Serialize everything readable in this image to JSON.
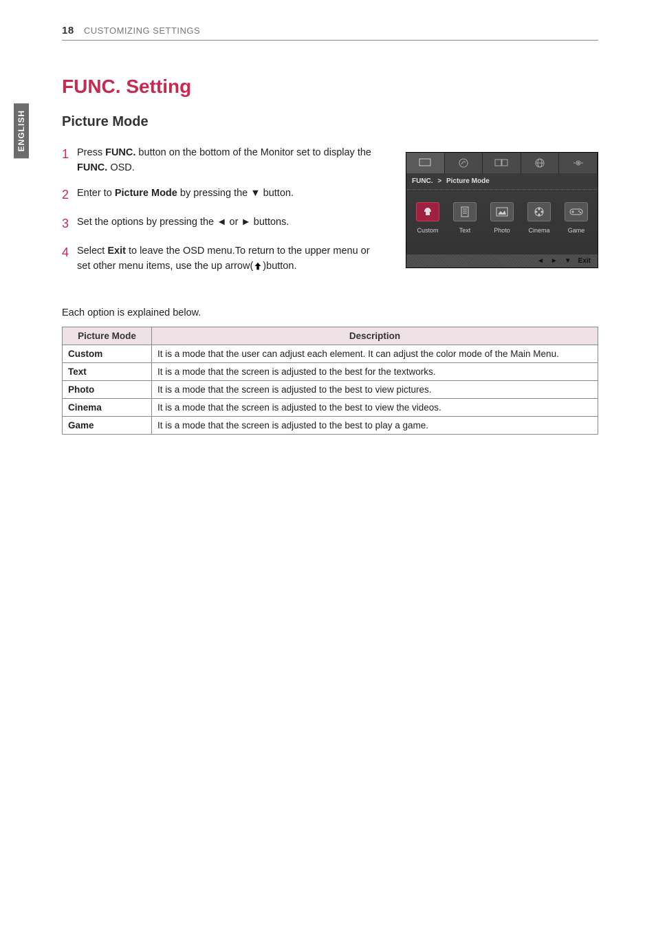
{
  "header": {
    "page_number": "18",
    "section": "CUSTOMIZING SETTINGS",
    "side_tab": "ENGLISH"
  },
  "title": "FUNC. Setting",
  "subtitle": "Picture Mode",
  "steps": {
    "s1": {
      "num": "1",
      "pre": "Press ",
      "b1": "FUNC.",
      "mid": " button on   the bottom of the Monitor set to display the ",
      "b2": "FUNC.",
      "post": " OSD."
    },
    "s2": {
      "num": "2",
      "pre": "Enter to ",
      "b1": "Picture Mode",
      "post": " by pressing the ▼ button."
    },
    "s3": {
      "num": "3",
      "text": "Set the options by pressing the ◄ or ► buttons."
    },
    "s4": {
      "num": "4",
      "pre": "Select ",
      "b1": "Exit",
      "post": " to leave the OSD menu.To return to the upper menu or set other menu items, use  the up arrow(",
      "post2": ")button."
    }
  },
  "explain_intro": "Each option is explained below.",
  "table": {
    "headers": {
      "mode": "Picture Mode",
      "desc": "Description"
    },
    "rows": [
      {
        "mode": "Custom",
        "desc": "It is a mode that the user can adjust each element. It can adjust the color mode of the Main Menu."
      },
      {
        "mode": "Text",
        "desc": "It is a mode that the screen is adjusted to the best for the textworks."
      },
      {
        "mode": "Photo",
        "desc": "It is a mode that the screen is adjusted to the best to view pictures."
      },
      {
        "mode": "Cinema",
        "desc": "It is a mode that the screen is adjusted to the best to view the videos."
      },
      {
        "mode": "Game",
        "desc": "It is a mode that the screen is adjusted to the best to play a game."
      }
    ]
  },
  "osd": {
    "breadcrumb_left": "FUNC.",
    "breadcrumb_sep": ">",
    "breadcrumb_right": "Picture Mode",
    "modes": [
      {
        "label": "Custom"
      },
      {
        "label": "Text"
      },
      {
        "label": "Photo"
      },
      {
        "label": "Cinema"
      },
      {
        "label": "Game"
      }
    ],
    "footer": {
      "left": "◄",
      "right": "►",
      "down": "▼",
      "exit": "Exit"
    }
  }
}
